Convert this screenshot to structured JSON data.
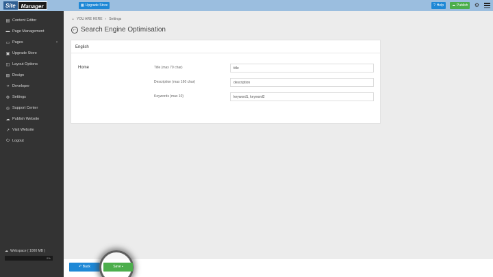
{
  "topbar": {
    "logo_part1": "Site",
    "logo_part2": "Manager",
    "upgrade_label": "Upgrade Store",
    "help_label": "Help",
    "publish_label": "Publish"
  },
  "sidebar": {
    "items": [
      {
        "label": "Content Editor",
        "icon": "file-icon"
      },
      {
        "label": "Page Management",
        "icon": "folder-icon"
      },
      {
        "label": "Pages",
        "icon": "folder-open-icon"
      },
      {
        "label": "Upgrade Store",
        "icon": "box-icon"
      },
      {
        "label": "Layout Options",
        "icon": "layout-icon"
      },
      {
        "label": "Design",
        "icon": "image-icon"
      },
      {
        "label": "Developer",
        "icon": "code-icon"
      },
      {
        "label": "Settings",
        "icon": "gear-icon"
      },
      {
        "label": "Support Center",
        "icon": "lifebuoy-icon"
      },
      {
        "label": "Publish Website",
        "icon": "cloud-icon"
      },
      {
        "label": "Visit Website",
        "icon": "external-link-icon"
      },
      {
        "label": "Logout",
        "icon": "power-icon"
      }
    ],
    "webspace_label": "Webspace ( 1000 MB )",
    "webspace_percent_label": "0%",
    "webspace_fraction": 0.0
  },
  "breadcrumb": {
    "home": "YOU ARE HERE",
    "current": "Settings"
  },
  "page": {
    "title": "Search Engine Optimisation"
  },
  "panel": {
    "language": "English",
    "page_name": "Home",
    "fields": [
      {
        "label": "Title (max 70 char)",
        "value": "title"
      },
      {
        "label": "Description (max 160 char)",
        "value": "description"
      },
      {
        "label": "Keywords (max 10)",
        "value": "keyword1, keyword2"
      }
    ]
  },
  "bottombar": {
    "back_label": "Back",
    "save_label": "Save"
  },
  "colors": {
    "topbar": "#9bbedf",
    "sidebar": "#333333",
    "primary": "#1e88d6",
    "success": "#4cae4c"
  }
}
